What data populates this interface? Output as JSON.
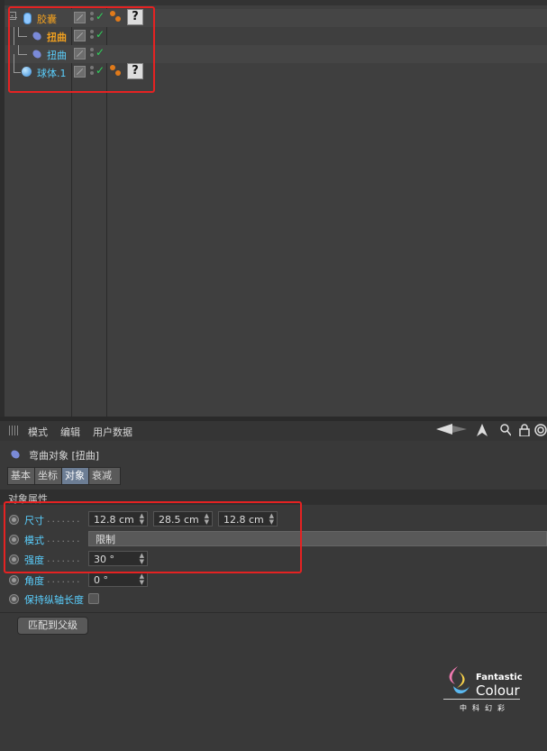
{
  "tree": [
    {
      "label": "胶囊",
      "color": "#f0a020",
      "icon": "capsule-icon"
    },
    {
      "label": "扭曲",
      "color": "#f0a020",
      "icon": "bend-deformer-icon"
    },
    {
      "label": "扭曲",
      "color": "#5ad0ff",
      "icon": "bend-deformer-icon"
    },
    {
      "label": "球体.1",
      "color": "#5ad0ff",
      "icon": "sphere-icon"
    }
  ],
  "attr": {
    "menu": [
      "模式",
      "编辑",
      "用户数据"
    ],
    "object_title": "弯曲对象 [扭曲]",
    "tabs": [
      "基本",
      "坐标",
      "对象",
      "衰减"
    ],
    "active_tab": "对象",
    "section": "对象属性",
    "props": {
      "size_label": "尺寸",
      "size_x": "12.8 cm",
      "size_y": "28.5 cm",
      "size_z": "12.8 cm",
      "mode_label": "模式",
      "mode_value": "限制",
      "strength_label": "强度",
      "strength_value": "30 °",
      "angle_label": "角度",
      "angle_value": "0 °",
      "keep_length_label": "保持纵轴长度"
    },
    "fit_button": "匹配到父级"
  },
  "logo": {
    "name_line1": "Fantastic",
    "name_line2": "Colour",
    "name_cn": "中科幻彩"
  },
  "colors": {
    "highlight": "#e52222",
    "label_cyan": "#5ad0ff",
    "label_orange": "#f0a020"
  }
}
